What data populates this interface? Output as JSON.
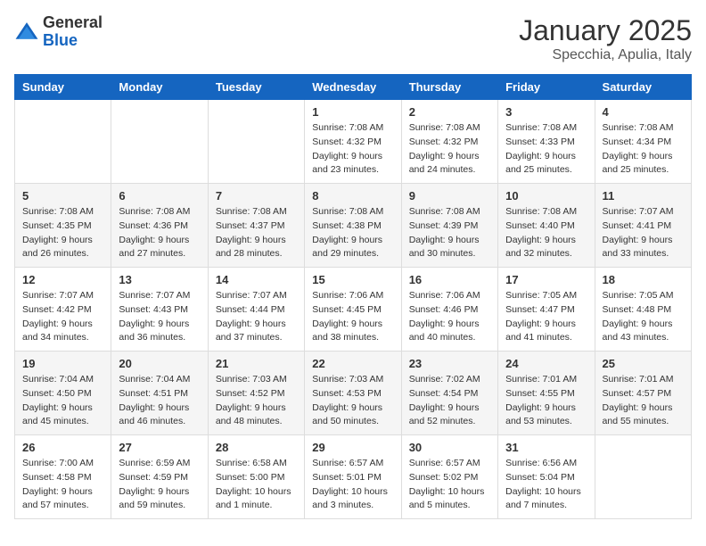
{
  "logo": {
    "general": "General",
    "blue": "Blue"
  },
  "title": {
    "month": "January 2025",
    "location": "Specchia, Apulia, Italy"
  },
  "weekdays": [
    "Sunday",
    "Monday",
    "Tuesday",
    "Wednesday",
    "Thursday",
    "Friday",
    "Saturday"
  ],
  "weeks": [
    [
      {
        "day": null,
        "info": null
      },
      {
        "day": null,
        "info": null
      },
      {
        "day": null,
        "info": null
      },
      {
        "day": "1",
        "info": "Sunrise: 7:08 AM\nSunset: 4:32 PM\nDaylight: 9 hours\nand 23 minutes."
      },
      {
        "day": "2",
        "info": "Sunrise: 7:08 AM\nSunset: 4:32 PM\nDaylight: 9 hours\nand 24 minutes."
      },
      {
        "day": "3",
        "info": "Sunrise: 7:08 AM\nSunset: 4:33 PM\nDaylight: 9 hours\nand 25 minutes."
      },
      {
        "day": "4",
        "info": "Sunrise: 7:08 AM\nSunset: 4:34 PM\nDaylight: 9 hours\nand 25 minutes."
      }
    ],
    [
      {
        "day": "5",
        "info": "Sunrise: 7:08 AM\nSunset: 4:35 PM\nDaylight: 9 hours\nand 26 minutes."
      },
      {
        "day": "6",
        "info": "Sunrise: 7:08 AM\nSunset: 4:36 PM\nDaylight: 9 hours\nand 27 minutes."
      },
      {
        "day": "7",
        "info": "Sunrise: 7:08 AM\nSunset: 4:37 PM\nDaylight: 9 hours\nand 28 minutes."
      },
      {
        "day": "8",
        "info": "Sunrise: 7:08 AM\nSunset: 4:38 PM\nDaylight: 9 hours\nand 29 minutes."
      },
      {
        "day": "9",
        "info": "Sunrise: 7:08 AM\nSunset: 4:39 PM\nDaylight: 9 hours\nand 30 minutes."
      },
      {
        "day": "10",
        "info": "Sunrise: 7:08 AM\nSunset: 4:40 PM\nDaylight: 9 hours\nand 32 minutes."
      },
      {
        "day": "11",
        "info": "Sunrise: 7:07 AM\nSunset: 4:41 PM\nDaylight: 9 hours\nand 33 minutes."
      }
    ],
    [
      {
        "day": "12",
        "info": "Sunrise: 7:07 AM\nSunset: 4:42 PM\nDaylight: 9 hours\nand 34 minutes."
      },
      {
        "day": "13",
        "info": "Sunrise: 7:07 AM\nSunset: 4:43 PM\nDaylight: 9 hours\nand 36 minutes."
      },
      {
        "day": "14",
        "info": "Sunrise: 7:07 AM\nSunset: 4:44 PM\nDaylight: 9 hours\nand 37 minutes."
      },
      {
        "day": "15",
        "info": "Sunrise: 7:06 AM\nSunset: 4:45 PM\nDaylight: 9 hours\nand 38 minutes."
      },
      {
        "day": "16",
        "info": "Sunrise: 7:06 AM\nSunset: 4:46 PM\nDaylight: 9 hours\nand 40 minutes."
      },
      {
        "day": "17",
        "info": "Sunrise: 7:05 AM\nSunset: 4:47 PM\nDaylight: 9 hours\nand 41 minutes."
      },
      {
        "day": "18",
        "info": "Sunrise: 7:05 AM\nSunset: 4:48 PM\nDaylight: 9 hours\nand 43 minutes."
      }
    ],
    [
      {
        "day": "19",
        "info": "Sunrise: 7:04 AM\nSunset: 4:50 PM\nDaylight: 9 hours\nand 45 minutes."
      },
      {
        "day": "20",
        "info": "Sunrise: 7:04 AM\nSunset: 4:51 PM\nDaylight: 9 hours\nand 46 minutes."
      },
      {
        "day": "21",
        "info": "Sunrise: 7:03 AM\nSunset: 4:52 PM\nDaylight: 9 hours\nand 48 minutes."
      },
      {
        "day": "22",
        "info": "Sunrise: 7:03 AM\nSunset: 4:53 PM\nDaylight: 9 hours\nand 50 minutes."
      },
      {
        "day": "23",
        "info": "Sunrise: 7:02 AM\nSunset: 4:54 PM\nDaylight: 9 hours\nand 52 minutes."
      },
      {
        "day": "24",
        "info": "Sunrise: 7:01 AM\nSunset: 4:55 PM\nDaylight: 9 hours\nand 53 minutes."
      },
      {
        "day": "25",
        "info": "Sunrise: 7:01 AM\nSunset: 4:57 PM\nDaylight: 9 hours\nand 55 minutes."
      }
    ],
    [
      {
        "day": "26",
        "info": "Sunrise: 7:00 AM\nSunset: 4:58 PM\nDaylight: 9 hours\nand 57 minutes."
      },
      {
        "day": "27",
        "info": "Sunrise: 6:59 AM\nSunset: 4:59 PM\nDaylight: 9 hours\nand 59 minutes."
      },
      {
        "day": "28",
        "info": "Sunrise: 6:58 AM\nSunset: 5:00 PM\nDaylight: 10 hours\nand 1 minute."
      },
      {
        "day": "29",
        "info": "Sunrise: 6:57 AM\nSunset: 5:01 PM\nDaylight: 10 hours\nand 3 minutes."
      },
      {
        "day": "30",
        "info": "Sunrise: 6:57 AM\nSunset: 5:02 PM\nDaylight: 10 hours\nand 5 minutes."
      },
      {
        "day": "31",
        "info": "Sunrise: 6:56 AM\nSunset: 5:04 PM\nDaylight: 10 hours\nand 7 minutes."
      },
      {
        "day": null,
        "info": null
      }
    ]
  ]
}
